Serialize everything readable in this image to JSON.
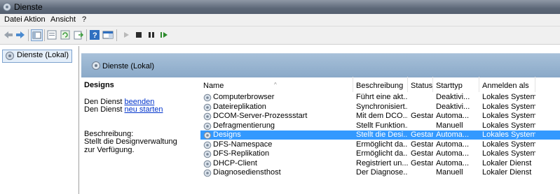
{
  "window": {
    "title": "Dienste"
  },
  "menu": [
    "Datei",
    "Aktion",
    "Ansicht",
    "?"
  ],
  "toolbar": {
    "buttons": [
      "back-icon",
      "forward-icon",
      "console-tree-icon",
      "properties-icon",
      "refresh-icon",
      "export-icon",
      "help-icon",
      "show-hide-icon",
      "play-icon",
      "stop-icon",
      "pause-icon",
      "resume-icon"
    ]
  },
  "tree": {
    "item": "Dienste (Lokal)"
  },
  "pane": {
    "header": "Dienste (Lokal)"
  },
  "details": {
    "title": "Designs",
    "prefix1": "Den Dienst ",
    "link1": "beenden",
    "prefix2": "Den Dienst ",
    "link2": "neu starten",
    "desc_label": "Beschreibung:",
    "desc_text": "Stellt die Designverwaltung zur Verfügung."
  },
  "table": {
    "columns": [
      "Name",
      "Beschreibung",
      "Status",
      "Starttyp",
      "Anmelden als"
    ],
    "rows": [
      [
        "Computerbrowser",
        "Führt eine akt...",
        "",
        "Deaktivi...",
        "Lokales System"
      ],
      [
        "Dateireplikation",
        "Synchronisiert...",
        "",
        "Deaktivi...",
        "Lokales System"
      ],
      [
        "DCOM-Server-Prozessstart",
        "Mit dem DCO...",
        "Gestartet",
        "Automa...",
        "Lokales System"
      ],
      [
        "Defragmentierung",
        "Stellt Funktion...",
        "",
        "Manuell",
        "Lokales System"
      ],
      [
        "Designs",
        "Stellt die Desi...",
        "Gestartet",
        "Automa...",
        "Lokales System"
      ],
      [
        "DFS-Namespace",
        "Ermöglicht da...",
        "Gestartet",
        "Automa...",
        "Lokales System"
      ],
      [
        "DFS-Replikation",
        "Ermöglicht da...",
        "Gestartet",
        "Automa...",
        "Lokales System"
      ],
      [
        "DHCP-Client",
        "Registriert un...",
        "Gestartet",
        "Automa...",
        "Lokaler Dienst"
      ],
      [
        "Diagnosediensthost",
        "Der Diagnose...",
        "",
        "Manuell",
        "Lokaler Dienst"
      ]
    ],
    "selected_row": 4
  },
  "colors": {
    "selection": "#3399ff",
    "pane_header": "#9bb6d2",
    "link": "#0033cc"
  }
}
